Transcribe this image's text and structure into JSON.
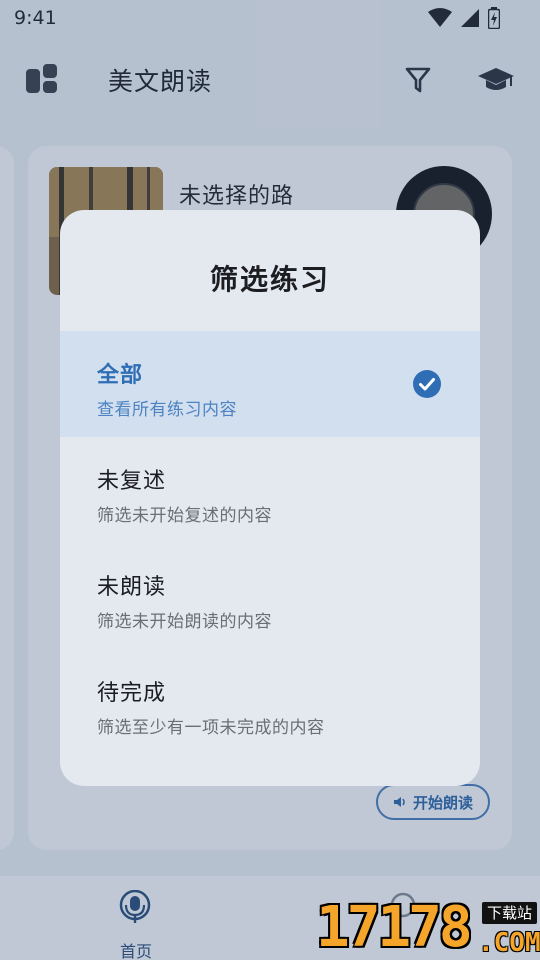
{
  "status_bar": {
    "time": "9:41"
  },
  "app_bar": {
    "title": "美文朗读"
  },
  "card": {
    "title": "未选择的路",
    "start_button_label": "开始朗读"
  },
  "bottom_nav": {
    "items": [
      {
        "label": "首页",
        "icon": "mic-icon",
        "active": true
      }
    ]
  },
  "dialog": {
    "title": "筛选练习",
    "options": [
      {
        "title": "全部",
        "subtitle": "查看所有练习内容",
        "selected": true
      },
      {
        "title": "未复述",
        "subtitle": "筛选未开始复述的内容",
        "selected": false
      },
      {
        "title": "未朗读",
        "subtitle": "筛选未开始朗读的内容",
        "selected": false
      },
      {
        "title": "待完成",
        "subtitle": "筛选至少有一项未完成的内容",
        "selected": false
      }
    ]
  },
  "watermark": {
    "number": "17178",
    "tag": "下载站",
    "domain": ".COM"
  },
  "colors": {
    "accent": "#2f6eb5",
    "selected_bg": "#d2dfee",
    "dialog_bg": "#e4e8ef",
    "watermark": "#f4a52a"
  }
}
